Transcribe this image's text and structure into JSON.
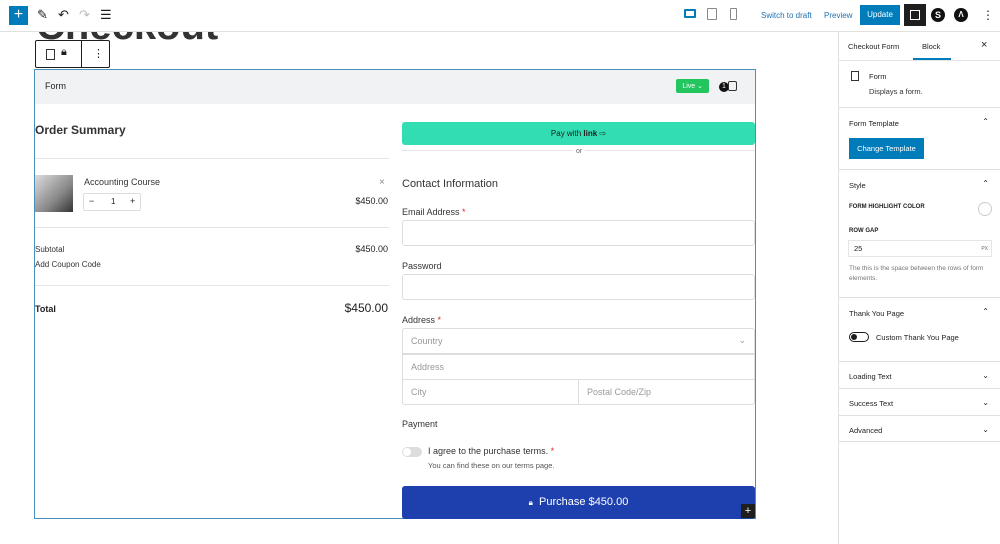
{
  "toolbar": {
    "add": "+",
    "switch_draft": "Switch to draft",
    "preview": "Preview",
    "update": "Update"
  },
  "page": {
    "title": "Checkout"
  },
  "form": {
    "header": "Form",
    "status": "Live",
    "cart_count": "1",
    "order_summary": "Order Summary",
    "item": {
      "name": "Accounting Course",
      "qty": "1",
      "price": "$450.00"
    },
    "subtotal_label": "Subtotal",
    "subtotal": "$450.00",
    "coupon": "Add Coupon Code",
    "total_label": "Total",
    "total": "$450.00",
    "pay_with": "Pay with",
    "link_brand": "link",
    "or": "or",
    "contact": "Contact Information",
    "email_label": "Email Address",
    "password_label": "Password",
    "address_label": "Address",
    "country_ph": "Country",
    "address_ph": "Address",
    "city_ph": "City",
    "postal_ph": "Postal Code/Zip",
    "payment": "Payment",
    "terms": "I agree to the purchase terms.",
    "terms_sub": "You can find these on our terms page.",
    "purchase": "Purchase $450.00"
  },
  "sidebar": {
    "tab1": "Checkout Form",
    "tab2": "Block",
    "block_name": "Form",
    "block_desc": "Displays a form.",
    "form_template": "Form Template",
    "change_template": "Change Template",
    "style": "Style",
    "highlight": "FORM HIGHLIGHT COLOR",
    "row_gap": "ROW GAP",
    "row_gap_value": "25",
    "unit": "PX",
    "row_gap_help": "The this is the space between the rows of form elements.",
    "thank_you": "Thank You Page",
    "custom_ty": "Custom Thank You Page",
    "loading": "Loading Text",
    "success": "Success Text",
    "advanced": "Advanced"
  },
  "colors": {
    "accent": "#007cba",
    "live": "#22c55e",
    "link_pay": "#33ddb3",
    "purchase": "#1e40af"
  }
}
